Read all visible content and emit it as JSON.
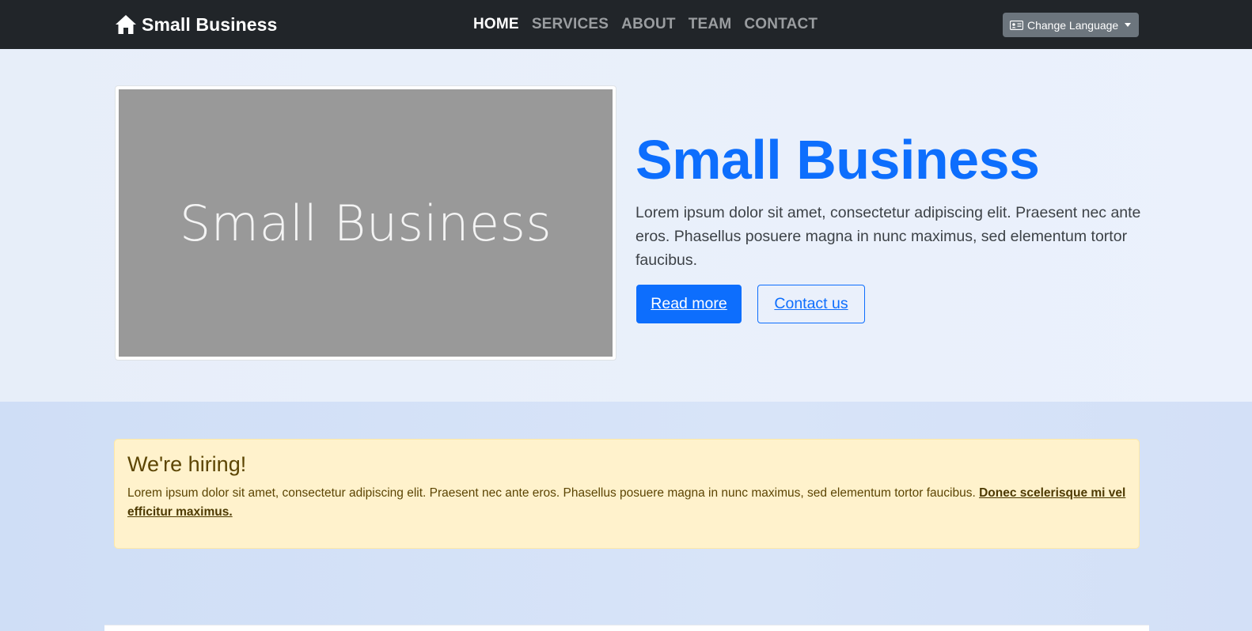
{
  "navbar": {
    "brand_text": "Small Business",
    "brand_icon": "home-icon",
    "links": [
      {
        "label": "HOME",
        "active": true
      },
      {
        "label": "SERVICES",
        "active": false
      },
      {
        "label": "ABOUT",
        "active": false
      },
      {
        "label": "TEAM",
        "active": false
      },
      {
        "label": "CONTACT",
        "active": false
      }
    ],
    "language_button": {
      "label": "Change Language",
      "icon": "id-card-icon"
    }
  },
  "hero": {
    "image_text": "Small Business",
    "title": "Small Business",
    "lead": "Lorem ipsum dolor sit amet, consectetur adipiscing elit. Praesent nec ante eros. Phasellus posuere magna in nunc maximus, sed elementum tortor faucibus.",
    "primary_button": "Read more",
    "secondary_button": "Contact us"
  },
  "alert": {
    "title": "We're hiring!",
    "text": "Lorem ipsum dolor sit amet, consectetur adipiscing elit. Praesent nec ante eros. Phasellus posuere magna in nunc maximus, sed elementum tortor faucibus. ",
    "link": "Donec scelerisque mi vel efficitur maximus."
  },
  "colors": {
    "navbar_bg": "#212529",
    "primary": "#0d6efd",
    "alert_bg": "#fff2cc",
    "alert_text": "#664d03",
    "language_button_bg": "#6c757d"
  }
}
